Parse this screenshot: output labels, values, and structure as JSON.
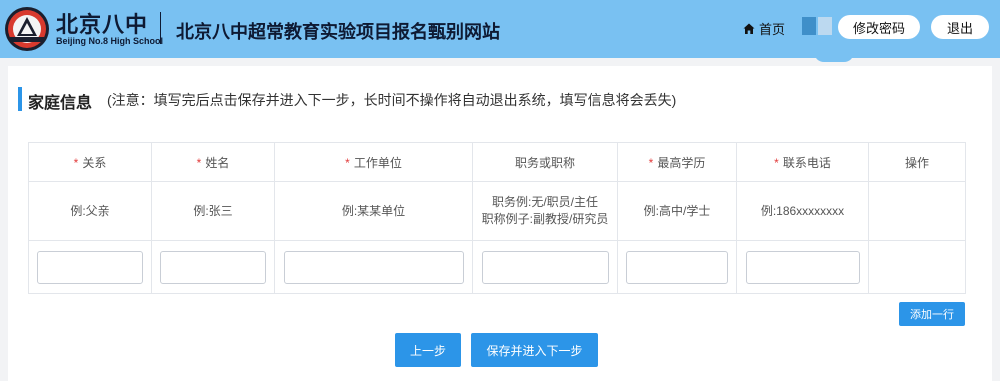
{
  "header": {
    "logo_cn": "北京八中",
    "logo_en": "Beijing No.8 High School",
    "site_title": "北京八中超常教育实验项目报名甄别网站",
    "home_label": "首页",
    "change_password": "修改密码",
    "logout": "退出"
  },
  "section": {
    "title": "家庭信息",
    "note": "(注意：填写完后点击保存并进入下一步，长时间不操作将自动退出系统，填写信息将会丢失)"
  },
  "table": {
    "required_mark": "*",
    "columns": [
      "关系",
      "姓名",
      "工作单位",
      "职务或职称",
      "最高学历",
      "联系电话",
      "操作"
    ],
    "examples": {
      "relation": "例:父亲",
      "name": "例:张三",
      "employer": "例:某某单位",
      "position_line1": "职务例:无/职员/主任",
      "position_line2": "职称例子:副教授/研究员",
      "education": "例:高中/学士",
      "phone": "例:186xxxxxxxx",
      "action": ""
    },
    "inputs": {
      "relation": "",
      "name": "",
      "employer": "",
      "position": "",
      "education": "",
      "phone": ""
    }
  },
  "buttons": {
    "add_row": "添加一行",
    "prev": "上一步",
    "save_next": "保存并进入下一步"
  },
  "colors": {
    "header_bg": "#79c1f2",
    "accent": "#2c95e8",
    "required": "#e23b3b"
  }
}
